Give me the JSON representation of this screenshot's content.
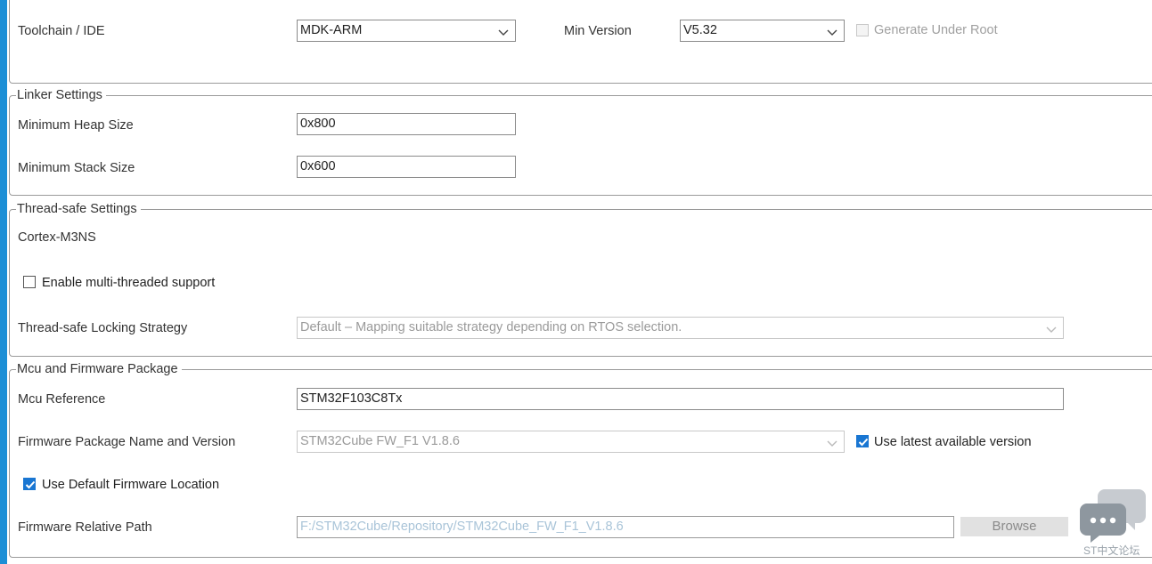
{
  "toolchain": {
    "label": "Toolchain / IDE",
    "value": "MDK-ARM",
    "min_version_label": "Min Version",
    "min_version_value": "V5.32",
    "generate_under_root_label": "Generate Under Root",
    "generate_under_root_checked": false
  },
  "linker": {
    "legend": "Linker Settings",
    "heap_label": "Minimum Heap Size",
    "heap_value": "0x800",
    "stack_label": "Minimum Stack Size",
    "stack_value": "0x600"
  },
  "thread": {
    "legend": "Thread-safe Settings",
    "core": "Cortex-M3NS",
    "multithread_label": "Enable multi-threaded support",
    "multithread_checked": false,
    "strategy_label": "Thread-safe Locking Strategy",
    "strategy_value": "Default – Mapping suitable strategy depending on RTOS selection."
  },
  "mcu": {
    "legend": "Mcu and Firmware Package",
    "reference_label": "Mcu Reference",
    "reference_value": "STM32F103C8Tx",
    "fw_label": "Firmware Package Name and Version",
    "fw_value": "STM32Cube FW_F1 V1.8.6",
    "use_latest_label": "Use latest available version",
    "use_latest_checked": true,
    "default_location_label": "Use Default Firmware Location",
    "default_location_checked": true,
    "path_label": "Firmware Relative Path",
    "path_value": "F:/STM32Cube/Repository/STM32Cube_FW_F1_V1.8.6",
    "browse_label": "Browse"
  },
  "watermark": {
    "text": "ST中文论坛",
    "icon": "chat-bubbles-icon"
  },
  "colors": {
    "accent": "#1976d2",
    "sidebar": "#1c8fd6",
    "border": "#9a9a9a"
  }
}
